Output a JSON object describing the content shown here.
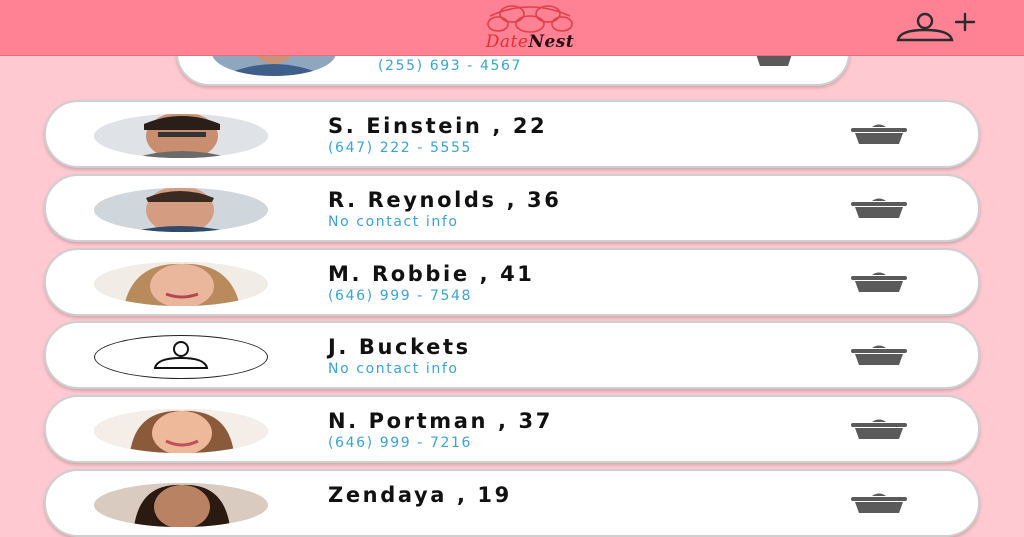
{
  "header": {
    "logo_part1": "Date",
    "logo_part2": "Nest",
    "add_contact_icon": "add-person-icon"
  },
  "contacts": [
    {
      "name": "",
      "phone": "(255) 693 - 4567",
      "avatar": "photo"
    },
    {
      "name": "S. Einstein , 22",
      "phone": "(647) 222 - 5555",
      "avatar": "photo"
    },
    {
      "name": "R. Reynolds , 36",
      "phone": "No contact info",
      "avatar": "photo"
    },
    {
      "name": "M. Robbie , 41",
      "phone": "(646) 999 - 7548",
      "avatar": "photo"
    },
    {
      "name": "J. Buckets",
      "phone": "No contact info",
      "avatar": "placeholder-person-icon"
    },
    {
      "name": "N. Portman , 37",
      "phone": "(646) 999 - 7216",
      "avatar": "photo"
    },
    {
      "name": "Zendaya , 19",
      "phone": "",
      "avatar": "photo"
    }
  ],
  "colors": {
    "header_bg": "#ff8294",
    "page_bg": "#ffc9d1",
    "phone_text": "#3aa3d4",
    "delete_icon": "#5a5a5a"
  }
}
